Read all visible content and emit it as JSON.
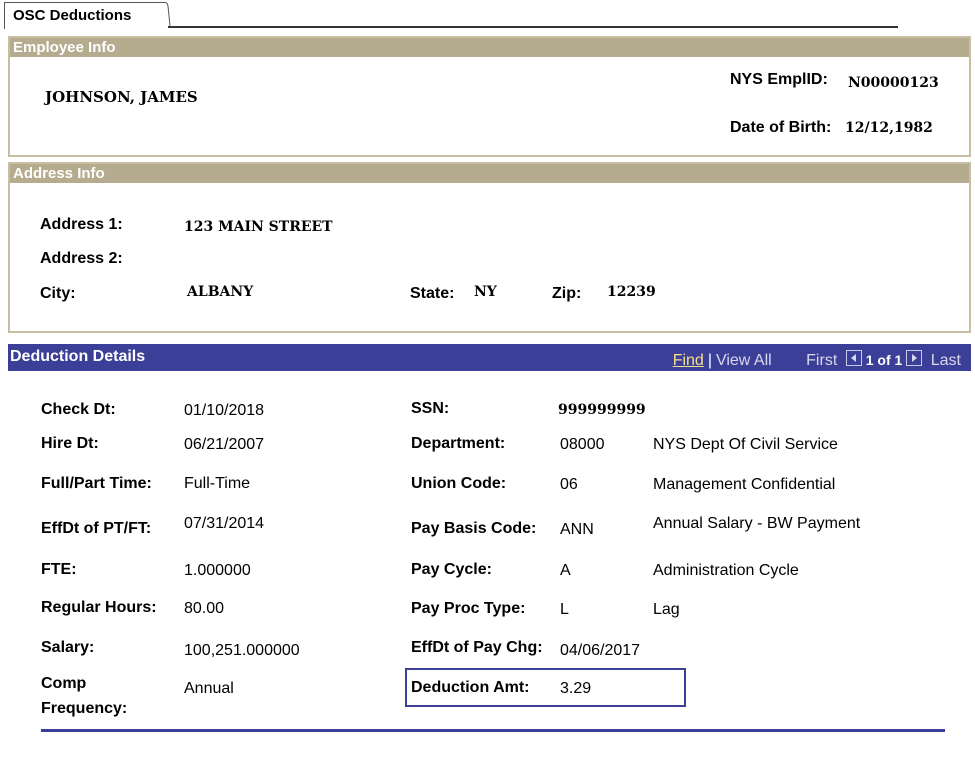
{
  "tab": {
    "label": "OSC Deductions"
  },
  "employee_info": {
    "header": "Employee Info",
    "name": "JOHNSON, JAMES",
    "empl_id_label": "NYS EmplID:",
    "empl_id": "N00000123",
    "dob_label": "Date of Birth:",
    "dob": "12/12,1982"
  },
  "address_info": {
    "header": "Address Info",
    "address1_label": "Address 1:",
    "address1": "123 MAIN STREET",
    "address2_label": "Address 2:",
    "address2": "",
    "city_label": "City:",
    "city": "ALBANY",
    "state_label": "State:",
    "state": "NY",
    "zip_label": "Zip:",
    "zip": "12239"
  },
  "deduction_details": {
    "header": "Deduction Details",
    "nav": {
      "find": "Find",
      "separator": "|",
      "view_all": "View All",
      "first": "First",
      "count": "1 of 1",
      "last": "Last",
      "prev_icon": "arrow-left-icon",
      "next_icon": "arrow-right-icon"
    },
    "check_dt_label": "Check Dt:",
    "check_dt": "01/10/2018",
    "hire_dt_label": "Hire Dt:",
    "hire_dt": "06/21/2007",
    "full_part_label": "Full/Part Time:",
    "full_part": "Full-Time",
    "effdt_ptft_label": "EffDt of PT/FT:",
    "effdt_ptft": "07/31/2014",
    "fte_label": "FTE:",
    "fte": "1.000000",
    "regular_hours_label": "Regular Hours:",
    "regular_hours": "80.00",
    "salary_label": "Salary:",
    "salary": "100,251.000000",
    "comp_freq_label_1": "Comp",
    "comp_freq_label_2": "Frequency:",
    "comp_freq": "Annual",
    "ssn_label": "SSN:",
    "ssn": "999999999",
    "department_label": "Department:",
    "department_code": "08000",
    "department_desc": "NYS Dept Of Civil Service",
    "union_code_label": "Union Code:",
    "union_code": "06",
    "union_desc": "Management Confidential",
    "pay_basis_label": "Pay Basis Code:",
    "pay_basis_code": "ANN",
    "pay_basis_desc": "Annual Salary - BW Payment",
    "pay_cycle_label": "Pay Cycle:",
    "pay_cycle_code": "A",
    "pay_cycle_desc": "Administration Cycle",
    "pay_proc_label": "Pay Proc Type:",
    "pay_proc_code": "L",
    "pay_proc_desc": "Lag",
    "effdt_pay_chg_label": "EffDt of Pay Chg:",
    "effdt_pay_chg": "04/06/2017",
    "deduction_amt_label": "Deduction Amt:",
    "deduction_amt": "3.29"
  },
  "colors": {
    "group_header": "#b5ab8e",
    "group_border": "#c8bfa3",
    "deduction_header": "#3c3f97",
    "find_link": "#f5e08a"
  }
}
